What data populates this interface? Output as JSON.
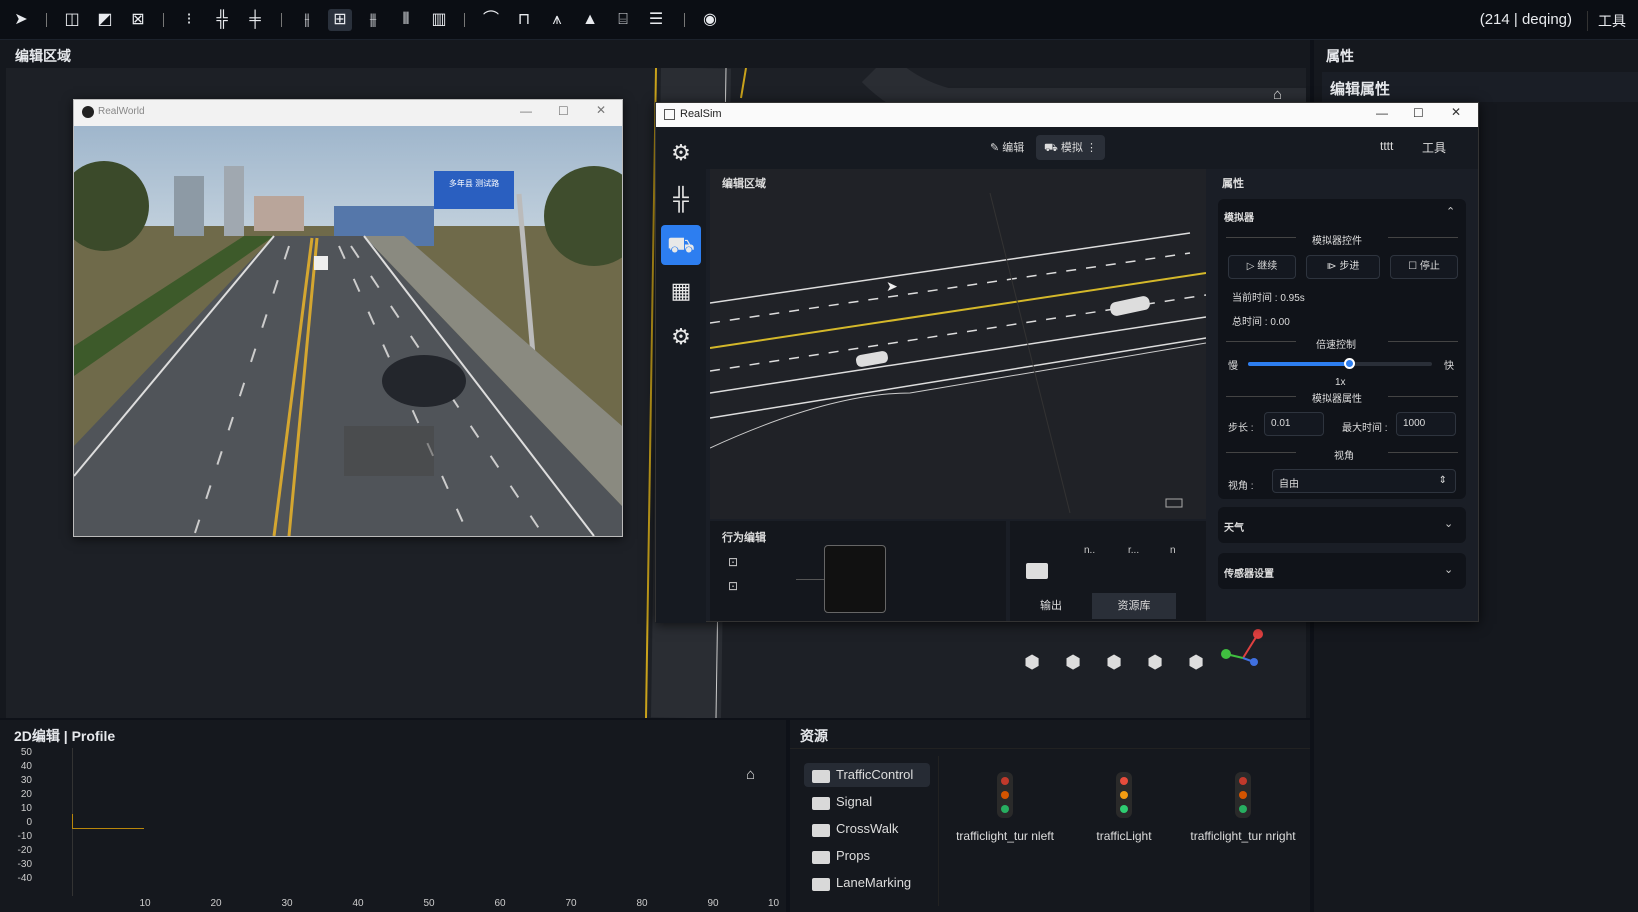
{
  "toolbar": {
    "icons": [
      "cursor-icon",
      "road-icon",
      "road-edit-icon",
      "road-delete-icon",
      "traffic-light-icon",
      "junction-icon",
      "junction-edit-icon",
      "lane-add-icon",
      "lane-width-icon",
      "lane-split-icon",
      "lane-merge-icon",
      "lane-marking-icon",
      "curve-icon",
      "bridge-icon",
      "tunnel-icon",
      "cone-icon",
      "sign-icon",
      "barrier-icon",
      "eye-icon"
    ],
    "user": "(214 | deqing)",
    "tools": "工具"
  },
  "edit_panel": {
    "title": "编辑区域"
  },
  "right_panel": {
    "title": "属性",
    "edit_props": "编辑属性"
  },
  "realworld": {
    "title": "RealWorld",
    "sign_text": "多年县 测试路"
  },
  "realsim": {
    "title": "RealSim",
    "edit_btn": "编辑",
    "sim_btn": "模拟",
    "user": "tttt",
    "tools": "工具",
    "canvas_title": "编辑区域",
    "props_title": "属性",
    "simulator": {
      "title": "模拟器",
      "controls_label": "模拟器控件",
      "continue": "继续",
      "step": "步进",
      "stop": "停止",
      "current_time": "当前时间 : 0.95s",
      "total_time": "总时间 : 0.00",
      "speed_label": "倍速控制",
      "slow": "慢",
      "fast": "快",
      "speed_value": "1x",
      "speed_level": 0.55,
      "attr_label": "模拟器属性",
      "step_label": "步长 :",
      "step_value": "0.01",
      "max_time_label": "最大时间 :",
      "max_time_value": "1000",
      "view_section": "视角",
      "view_label": "视角 :",
      "view_value": "自由"
    },
    "weather": "天气",
    "sensor": "传感器设置",
    "behavior_title": "行为编辑",
    "output_tab": "输出",
    "library_tab": "资源库",
    "out_cols": [
      "n..",
      "r...",
      "n"
    ]
  },
  "profile": {
    "title": "2D编辑 | Profile",
    "y_ticks": [
      "50",
      "40",
      "30",
      "20",
      "10",
      "0",
      "-10",
      "-20",
      "-30",
      "-40"
    ],
    "x_ticks": [
      "10",
      "20",
      "30",
      "40",
      "50",
      "60",
      "70",
      "80",
      "90",
      "10"
    ]
  },
  "resources": {
    "title": "资源",
    "folders": [
      "TrafficControl",
      "Signal",
      "CrossWalk",
      "Props",
      "LaneMarking"
    ],
    "assets": [
      {
        "name": "trafficlight_tur nleft",
        "colors": [
          "#c0392b",
          "#d35400",
          "#27ae60"
        ]
      },
      {
        "name": "trafficLight",
        "colors": [
          "#e74c3c",
          "#f39c12",
          "#2ecc71"
        ]
      },
      {
        "name": "trafficlight_tur nright",
        "colors": [
          "#c0392b",
          "#d35400",
          "#27ae60"
        ]
      }
    ]
  }
}
